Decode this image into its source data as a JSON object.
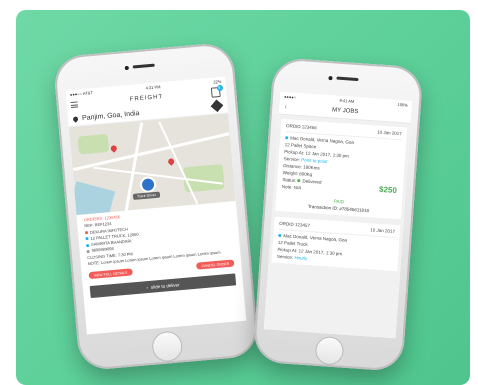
{
  "phone1": {
    "status": {
      "carrier": "●●●○○ AT&T",
      "time": "4:21 PM",
      "battery": "22%"
    },
    "title": "FREIGHT",
    "cart_count": "5",
    "location": "Panjim, Goa, India",
    "map_tooltip": "Track Driver",
    "details": {
      "orderid": "ORDERID: 1236456",
      "ref": "REF: REF1234",
      "company": "DEKURA INFOTECH",
      "truck": "12 PALLET TRUCK, 12060",
      "person": "SAMARTA BHANDARI",
      "phone": "9898989898",
      "closing": "CLOSING TIME: 7:30 PM",
      "note": "NOTE: Lorem ipsum Lorem ipsum Lorem ipsum Lorem ipsum Lorem ipsum"
    },
    "btn_view": "VIEW FULL DETAILS",
    "btn_cancel": "CANCEL ORDER",
    "slide": "slide to deliver"
  },
  "phone2": {
    "status": {
      "carrier": "●●●●○ ",
      "time": "9:41 AM",
      "battery": "100%"
    },
    "title": "MY JOBS",
    "jobs": [
      {
        "id": "ORDID 123456",
        "date": "10 Jan 2017",
        "pickup_loc": "Mac Donald, Verna Nagoa, Goa",
        "pallet": "12 Pallet Space",
        "pickup_at": "Pickup At: 12 Jan 2017, 1:30 pm",
        "service_label": "Service:",
        "service": "Point to point",
        "distance": "Distance: 180Kms",
        "weight": "Weight: 600Kg",
        "status_label": "Status:",
        "status": "Delivered",
        "note": "Note: N/A",
        "price": "$250",
        "paid": "PAID",
        "txn": "Transaction ID: #78545611818"
      },
      {
        "id": "ORDID 123457",
        "date": "10 Jan 2017",
        "pickup_loc": "Mac Donald, Verna Nagoa, Goa",
        "pallet": "12 Pallet Truck",
        "pickup_at": "Pickup At: 12 Jan 2017, 1:30 pm",
        "service_label": "Service:",
        "service": "Hourly"
      }
    ]
  },
  "colors": {
    "background": "#5ccf98",
    "accent_red": "#f25b57",
    "accent_cyan": "#19b5ea",
    "accent_green": "#4caf50"
  }
}
